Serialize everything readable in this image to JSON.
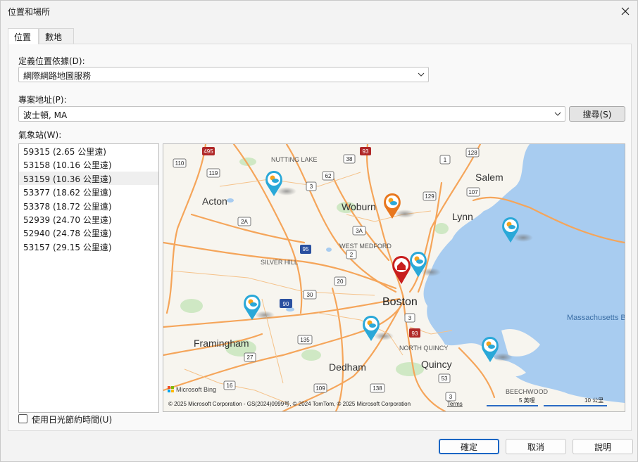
{
  "window": {
    "title": "位置和場所"
  },
  "tabs": [
    {
      "label": "位置"
    },
    {
      "label": "數地"
    }
  ],
  "location_source": {
    "label": "定義位置依據(D):",
    "value": "網際網路地圖服務"
  },
  "address": {
    "label": "專案地址(P):",
    "value": "波士頓, MA",
    "search_button": "搜尋(S)"
  },
  "stations": {
    "label": "氣象站(W):",
    "items": [
      "59315 (2.65 公里遠)",
      "53158 (10.16 公里遠)",
      "53159 (10.36 公里遠)",
      "53377 (18.62 公里遠)",
      "53378 (18.72 公里遠)",
      "52939 (24.70 公里遠)",
      "52940 (24.78 公里遠)",
      "53157 (29.15 公里遠)"
    ],
    "selected_index": 2
  },
  "map": {
    "cities": {
      "acton": "Acton",
      "woburn": "Woburn",
      "salem": "Salem",
      "lynn": "Lynn",
      "boston": "Boston",
      "framingham": "Framingham",
      "dedham": "Dedham",
      "quincy": "Quincy"
    },
    "places": {
      "nutting_lake": "NUTTING LAKE",
      "west_medford": "WEST MEDFORD",
      "silver_hill": "SILVER HILL",
      "north_quincy": "NORTH QUINCY",
      "beechwood": "BEECHWOOD",
      "mass_bay": "Massachusetts B"
    },
    "routes": [
      "495",
      "93",
      "128",
      "110",
      "38",
      "62",
      "119",
      "3",
      "1",
      "129",
      "107",
      "2A",
      "3A",
      "95",
      "2",
      "20",
      "30",
      "90",
      "3",
      "135",
      "27",
      "109",
      "138",
      "3",
      "16",
      "53",
      "93"
    ],
    "branding": "Microsoft Bing",
    "copyright": "© 2025 Microsoft Corporation - GS(2024)0999号, © 2024 TomTom, © 2025 Microsoft Corporation",
    "terms": "Terms",
    "scale_imperial": "5 英哩",
    "scale_metric": "10 公里",
    "colors": {
      "water": "#a8ccf0",
      "road": "#f5a55a",
      "land": "#f7f5ef",
      "park": "#cfe8c4",
      "station_pin": "#2aa8d8",
      "selected_pin": "#e8771e",
      "home_pin": "#c81e1e"
    }
  },
  "dst_checkbox": {
    "label": "使用日光節約時間(U)",
    "checked": false
  },
  "buttons": {
    "ok": "確定",
    "cancel": "取消",
    "help": "說明"
  }
}
